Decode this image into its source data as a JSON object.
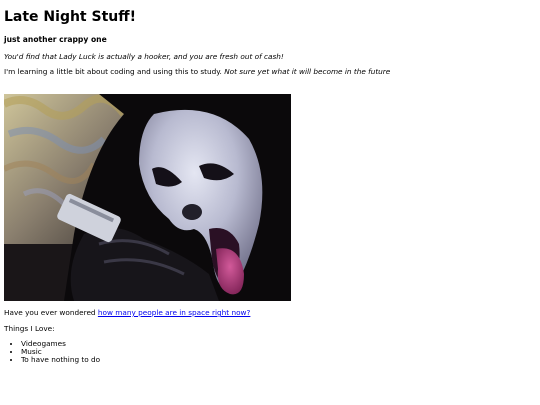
{
  "page": {
    "title": "Late Night Stuff!",
    "subtitle": "just another crappy one",
    "quote": "You'd find that Lady Luck is actually a hooker, and you are fresh out of cash!",
    "intro_plain": "I'm learning a little bit about coding and using this to study. ",
    "intro_italic": "Not sure yet what it will become in the future",
    "question_prefix": "Have you ever wondered ",
    "question_link": "how many people are in space right now?",
    "things_heading": "Things I Love:",
    "things": [
      "Videogames",
      "Music",
      "To have nothing to do"
    ]
  },
  "colors": {
    "background": "#ffffff",
    "text": "#000000",
    "link": "#0000ee"
  },
  "image": {
    "subject": "ghostface-mask-photo"
  }
}
